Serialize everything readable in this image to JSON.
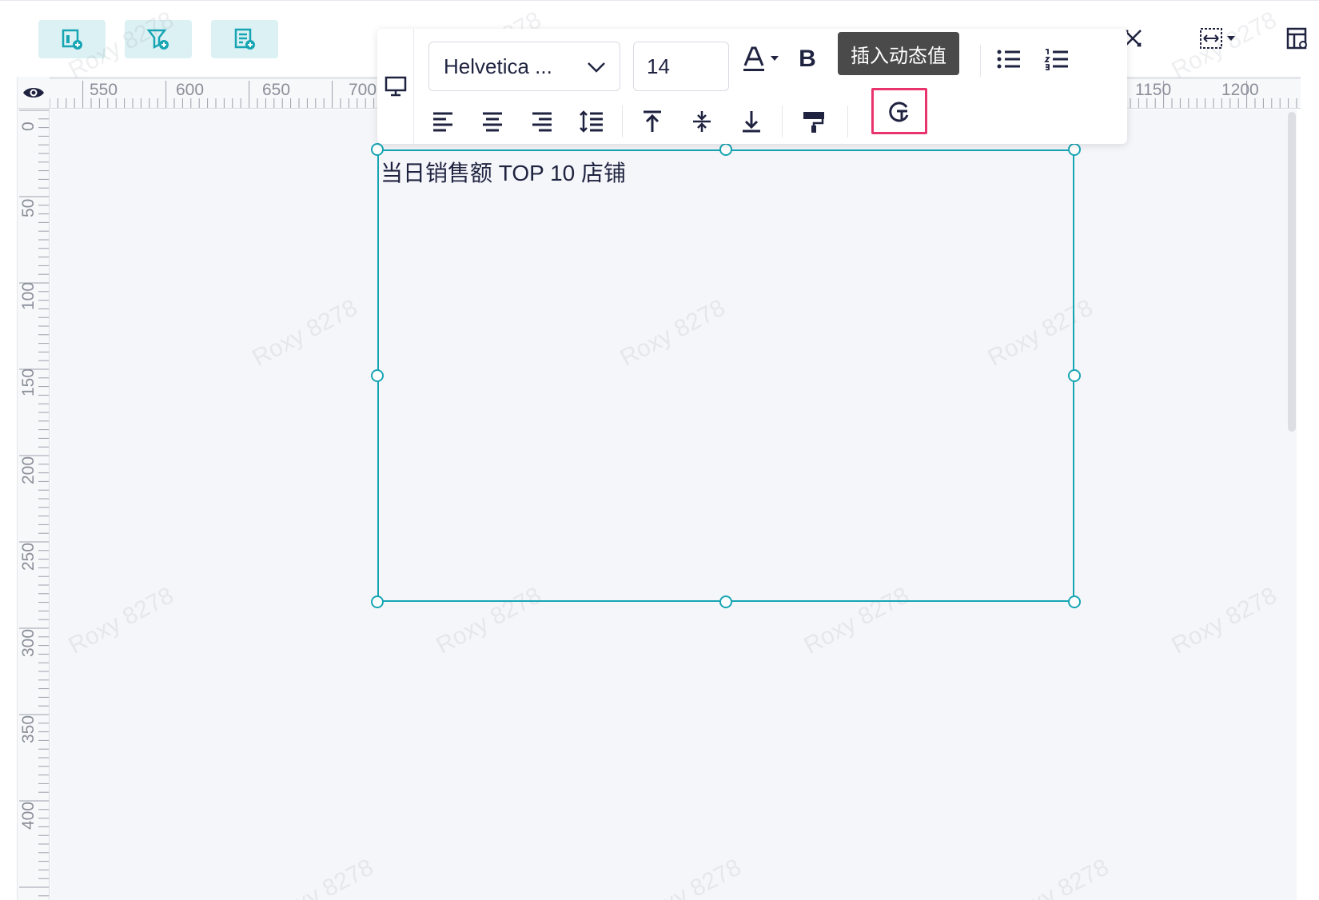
{
  "toolbar": {
    "left_buttons": [
      {
        "icon": "add-dashboard-icon"
      },
      {
        "icon": "add-filter-icon"
      },
      {
        "icon": "add-form-icon"
      }
    ],
    "right_icons": [
      "tools-icon",
      "fit-width-icon",
      "layout-panel-icon"
    ]
  },
  "ruler": {
    "horizontal_labels": [
      "550",
      "600",
      "650",
      "700",
      "1150",
      "1200"
    ],
    "vertical_labels": [
      "0",
      "50",
      "100",
      "150",
      "200",
      "250",
      "300",
      "350",
      "400"
    ]
  },
  "format_toolbar": {
    "font_family": "Helvetica ...",
    "font_size": "14",
    "bold_label": "B",
    "tooltip": "插入动态值"
  },
  "textbox": {
    "content": "当日销售额 TOP 10 店铺"
  },
  "watermark": "Roxy 8278",
  "colors": {
    "accent": "#17a5b4",
    "highlight": "#e8336d",
    "button_bg": "#dcf1f3",
    "canvas_bg": "#f5f6fa"
  }
}
